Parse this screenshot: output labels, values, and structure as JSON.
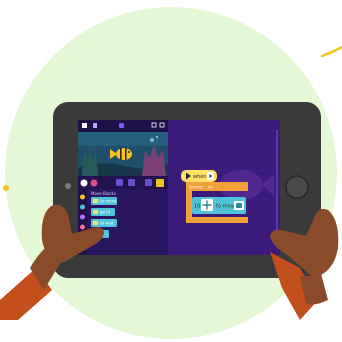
{
  "colors": {
    "page_bg": "#ffffff",
    "circle_bg": "#e5f8d6",
    "accent_yellow": "#f4c21b",
    "tablet_body": "#3a3a3a",
    "stage_water": "#1f4f6b",
    "code_area": "#3a1a7a",
    "sidebar": "#24124f",
    "block_motion": "#4fc3d9",
    "block_control": "#f0a13a",
    "block_yellow": "#ffe066",
    "skin": "#8a4b2a",
    "sleeve": "#c24e1c"
  },
  "stage_toolbar": {
    "home_icon": "home-icon",
    "flag_icon": "flag-icon",
    "fullscreen_icon": "fullscreen-icon"
  },
  "sprite": {
    "icon": "fish-icon"
  },
  "sidebar": {
    "header": "Move Blocks",
    "blocks": [
      {
        "icon": "arrow-right-icon",
        "text": "to move"
      },
      {
        "icon": "loop-icon",
        "text": "go to"
      },
      {
        "icon": "clock-icon",
        "text": "to wait"
      },
      {
        "icon": "flag-icon",
        "text": ""
      }
    ]
  },
  "code_blocks": {
    "event_label": "when",
    "control_label": "forever",
    "control_value": "ok",
    "move_prefix": "10",
    "move_label": "to move"
  }
}
